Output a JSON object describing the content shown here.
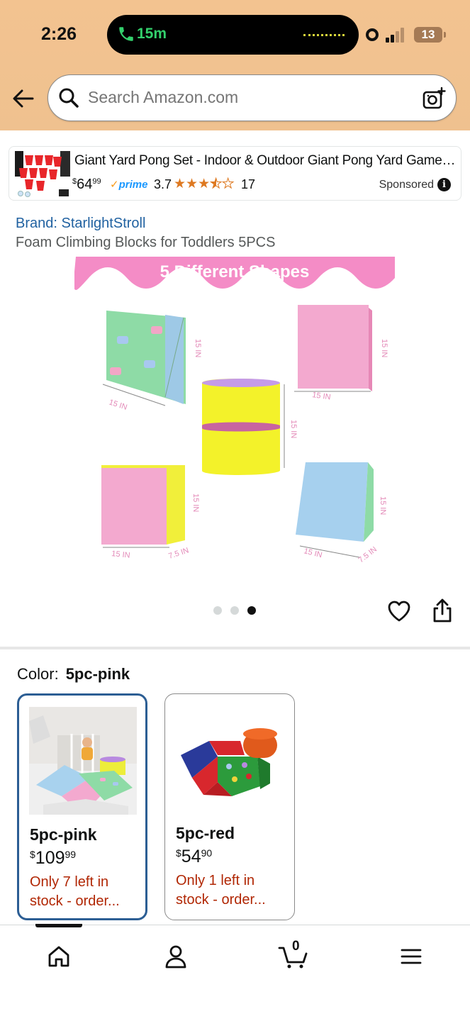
{
  "status_bar": {
    "time": "2:26",
    "call_duration": "15m",
    "battery": "13"
  },
  "search": {
    "placeholder": "Search Amazon.com"
  },
  "sponsored_ad": {
    "title": "Giant Yard Pong Set - Indoor & Outdoor Giant Pong Yard Game -...",
    "price_currency": "$",
    "price_whole": "64",
    "price_fraction": "99",
    "prime_label": "prime",
    "rating": "3.7",
    "rating_value": 3.7,
    "rating_max": 5,
    "review_count": "17",
    "sponsored_label": "Sponsored"
  },
  "product": {
    "brand": "Brand: StarlightStroll",
    "title": "Foam Climbing Blocks for Toddlers 5PCS",
    "image_banner": "5 Different Shapes",
    "dimension_labels": [
      "15 IN",
      "15 IN",
      "15 IN",
      "15 IN",
      "15 IN",
      "15 IN",
      "15 IN",
      "7.5 IN",
      "15 IN",
      "15 IN",
      "7.5 IN"
    ],
    "image_count": 3,
    "active_image": 3
  },
  "color_selector": {
    "label": "Color:",
    "selected": "5pc-pink",
    "options": [
      {
        "name": "5pc-pink",
        "price_currency": "$",
        "price_whole": "109",
        "price_fraction": "99",
        "stock": "Only 7 left in stock - order..."
      },
      {
        "name": "5pc-red",
        "price_currency": "$",
        "price_whole": "54",
        "price_fraction": "90",
        "stock": "Only 1 left in stock - order..."
      }
    ]
  },
  "bottom_nav": {
    "cart_count": "0",
    "items": [
      "home-icon",
      "account-icon",
      "cart-icon",
      "menu-icon"
    ]
  },
  "colors": {
    "header_bg": "#f3c390",
    "link_blue": "#2162a1",
    "stock_red": "#b12704",
    "selected_border": "#2c5e94",
    "star_orange": "#de7921",
    "banner_pink": "#f48cc6"
  }
}
